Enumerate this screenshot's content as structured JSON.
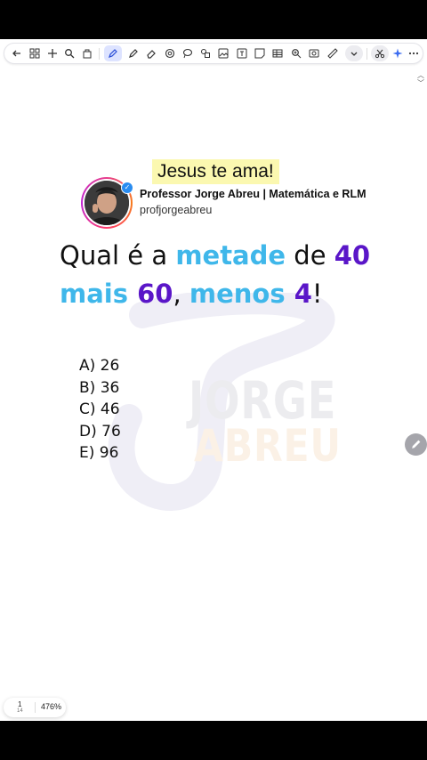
{
  "toolbar": {
    "tools": [
      "back-icon",
      "grid-icon",
      "add-icon",
      "search-icon",
      "share-icon",
      "pen-icon",
      "highlighter-icon",
      "eraser-icon",
      "lasso-icon",
      "lasso-select-icon",
      "shapes-icon",
      "image-icon",
      "text-icon",
      "sticky-note-icon",
      "emoji-icon",
      "table-icon",
      "zoom-icon",
      "screenshot-icon",
      "ruler-icon",
      "chevron-down-icon",
      "scissors-icon",
      "sparkle-icon",
      "more-icon"
    ]
  },
  "post": {
    "highlight_title": "Jesus te ama!",
    "author_name": "Professor Jorge Abreu | Matemática e RLM",
    "author_handle": "profjorgeabreu",
    "verified_mark": "✓"
  },
  "question": {
    "line1": [
      {
        "text": "Qual é a ",
        "style": "plain"
      },
      {
        "text": "metade",
        "style": "blue"
      },
      {
        "text": " de ",
        "style": "plain"
      },
      {
        "text": "40",
        "style": "purple"
      }
    ],
    "line2": [
      {
        "text": "mais ",
        "style": "blue"
      },
      {
        "text": "60",
        "style": "purple"
      },
      {
        "text": ", ",
        "style": "plain"
      },
      {
        "text": "menos ",
        "style": "blue"
      },
      {
        "text": "4",
        "style": "purple"
      },
      {
        "text": "!",
        "style": "plain"
      }
    ]
  },
  "options": [
    "A) 26",
    "B) 36",
    "C) 46",
    "D) 76",
    "E) 96"
  ],
  "watermark": {
    "line1": "JORGE",
    "line2": "ABREU"
  },
  "page_indicator": {
    "current": "1",
    "total": "14",
    "zoom": "476%"
  },
  "colors": {
    "accent_blue": "#3fb7ea",
    "accent_purple": "#5a16c8",
    "highlight_yellow": "#fbf8b0",
    "verified_blue": "#2a8cf0"
  }
}
